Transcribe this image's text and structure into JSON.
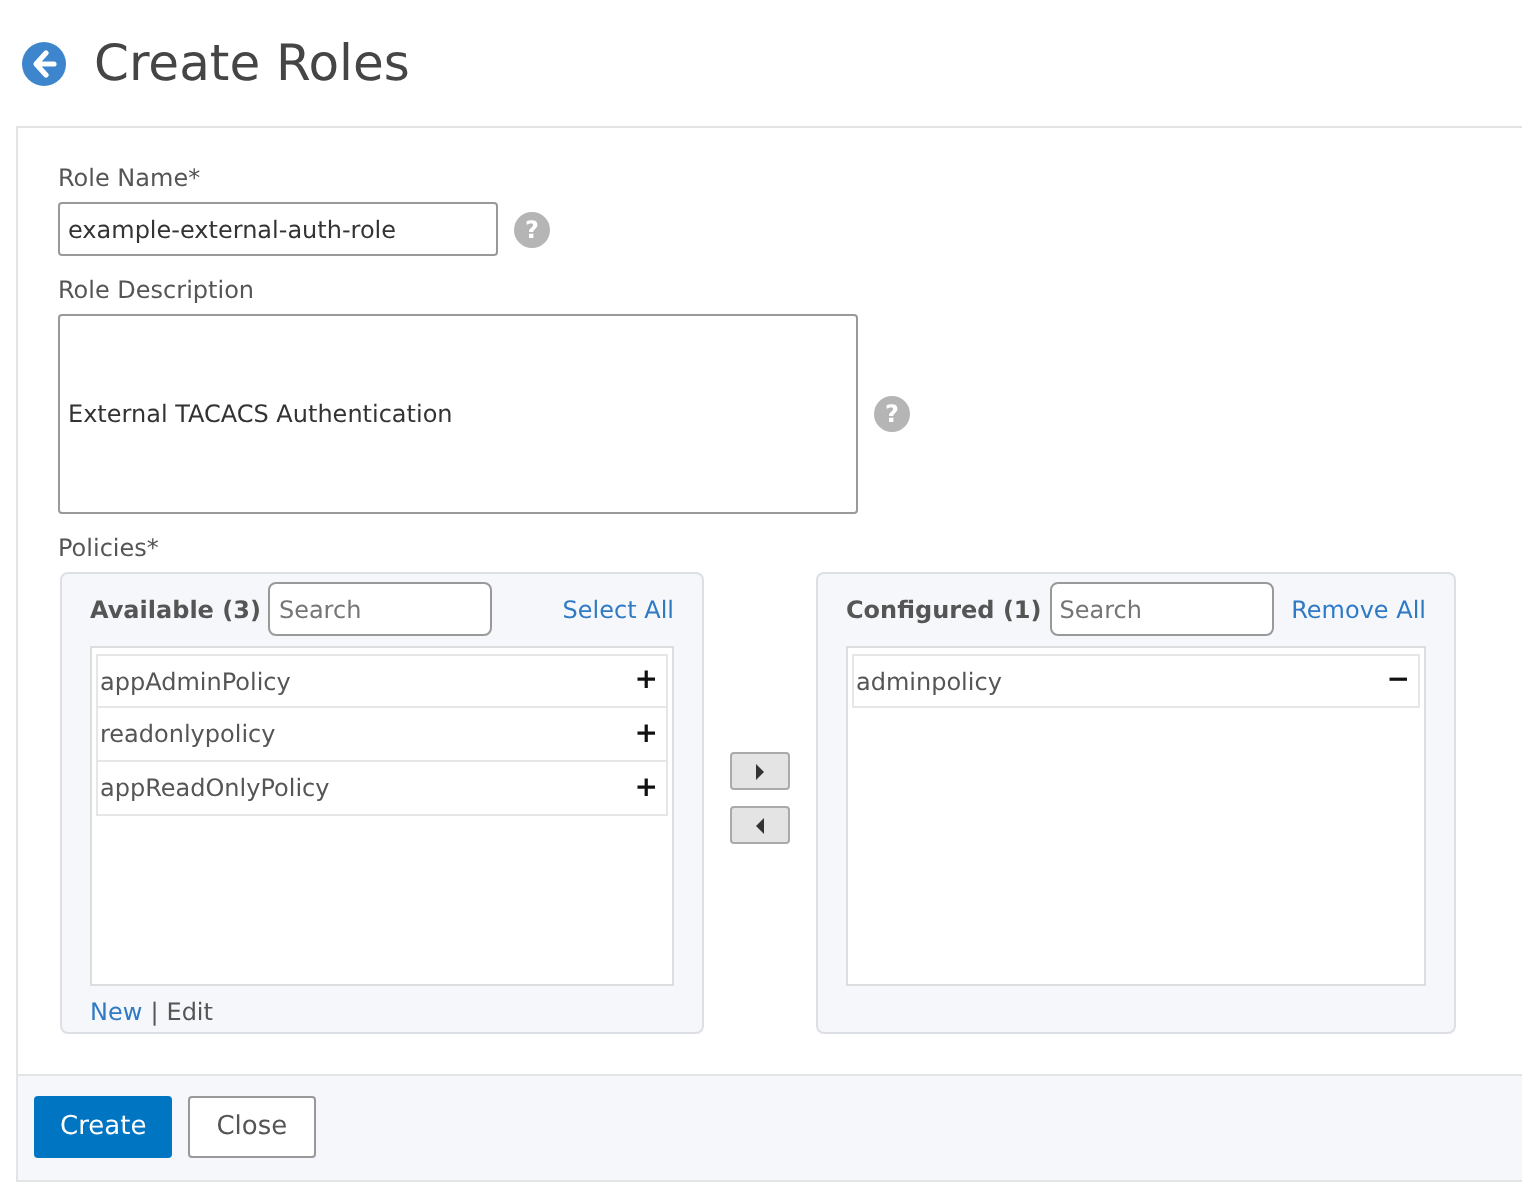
{
  "title": "Create Roles",
  "fields": [
    {
      "label": "Role Name*",
      "kind": "input",
      "value": "example-external-auth-role",
      "help": "?"
    },
    {
      "label": "Role Description",
      "kind": "textarea",
      "value": "External TACACS Authentication",
      "help": "?"
    }
  ],
  "policies": {
    "label": "Policies*",
    "available": {
      "heading": "Available (3)",
      "placeholder": "Search",
      "link": "Select All",
      "items": [
        {
          "name": "appAdminPolicy",
          "action": "+"
        },
        {
          "name": "readonlypolicy",
          "action": "+"
        },
        {
          "name": "appReadOnlyPolicy",
          "action": "+"
        }
      ],
      "footer_links": [
        "New",
        "Edit"
      ],
      "separator": "|"
    },
    "configured": {
      "heading": "Configured (1)",
      "placeholder": "Search",
      "link": "Remove All",
      "items": [
        {
          "name": "adminpolicy",
          "action": "−"
        }
      ]
    }
  },
  "buttons": [
    {
      "label": "Create",
      "kind": "primary"
    },
    {
      "label": "Close",
      "kind": "secondary"
    }
  ]
}
